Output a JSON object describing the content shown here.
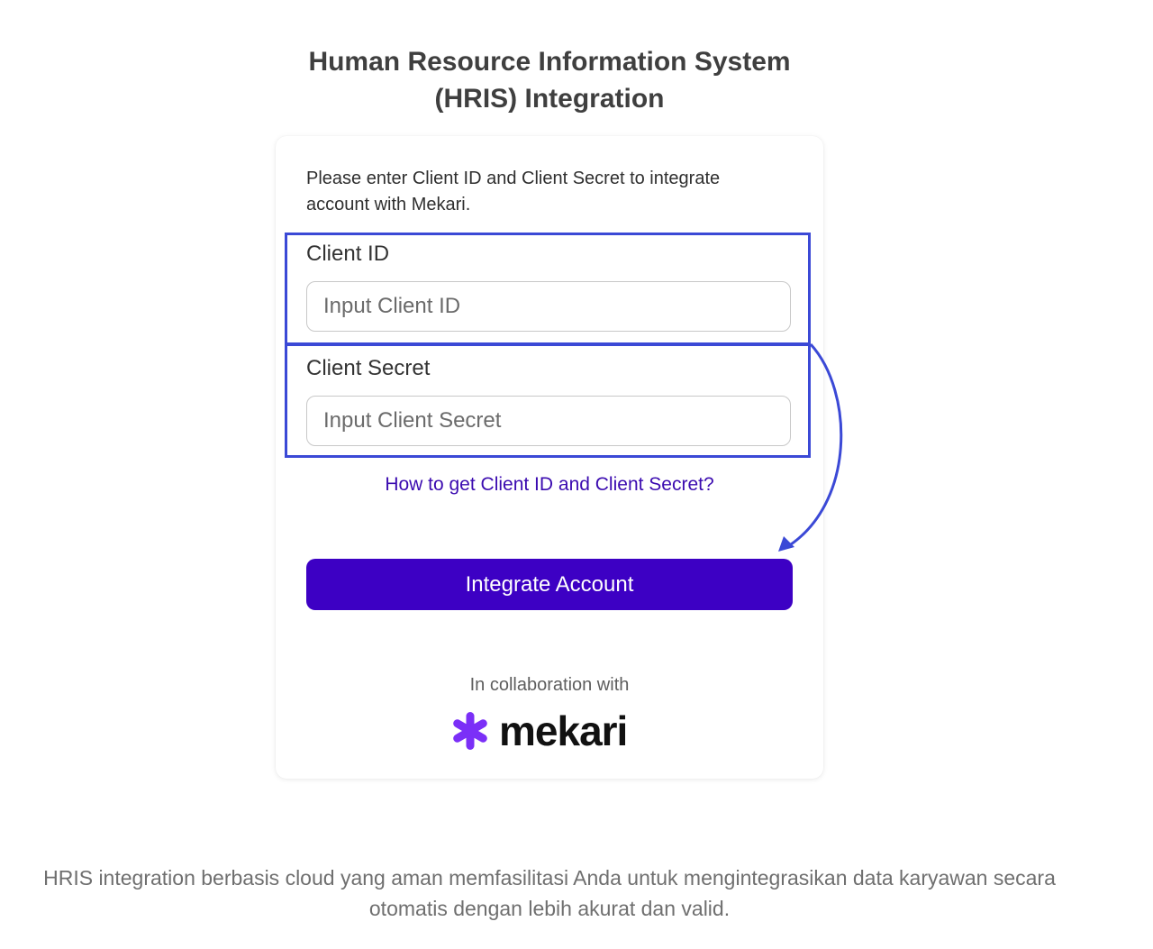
{
  "header": {
    "title_line1": "Human Resource Information System",
    "title_line2": "(HRIS) Integration"
  },
  "form": {
    "intro": "Please enter Client ID and Client Secret to integrate account with Mekari.",
    "client_id": {
      "label": "Client ID",
      "placeholder": "Input Client ID",
      "value": ""
    },
    "client_secret": {
      "label": "Client Secret",
      "placeholder": "Input Client Secret",
      "value": ""
    },
    "help_link": "How to get Client ID and Client Secret?",
    "submit_label": "Integrate Account"
  },
  "partner": {
    "collab_text": "In collaboration with",
    "logo_text": "mekari",
    "logo_icon": "mekari-star-icon"
  },
  "footer": {
    "description": "HRIS integration berbasis cloud yang aman memfasilitasi Anda untuk mengintegrasikan data karyawan secara otomatis dengan lebih akurat dan valid."
  },
  "colors": {
    "primary": "#3d00c4",
    "link": "#3b0bb0",
    "annotation": "#3b49d6",
    "logo_star": "#7b2ff7"
  }
}
